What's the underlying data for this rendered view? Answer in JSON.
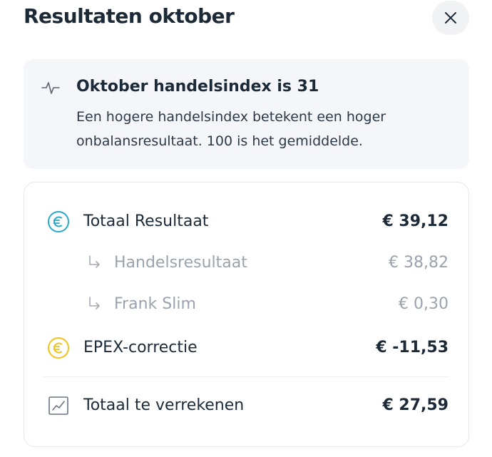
{
  "header": {
    "title": "Resultaten oktober",
    "close_icon": "close-icon"
  },
  "info": {
    "icon": "activity-pulse-icon",
    "heading": "Oktober handelsindex is 31",
    "text": "Een hogere handelsindex betekent een hoger onbalansresultaat. 100 is het gemiddelde."
  },
  "results": {
    "total": {
      "icon": "euro-circle-icon",
      "icon_color": "#2aa8c9",
      "label": "Totaal Resultaat",
      "value": "€ 39,12"
    },
    "sub_items": [
      {
        "icon": "sub-arrow-icon",
        "label": "Handelsresultaat",
        "value": "€ 38,82"
      },
      {
        "icon": "sub-arrow-icon",
        "label": "Frank Slim",
        "value": "€ 0,30"
      }
    ],
    "epex": {
      "icon": "euro-circle-icon",
      "icon_color": "#f2c21b",
      "label": "EPEX-correctie",
      "value": "€ -11,53"
    },
    "settlement": {
      "icon": "chart-trend-icon",
      "label": "Totaal te verrekenen",
      "value": "€ 27,59"
    }
  },
  "colors": {
    "text_primary": "#1c2a38",
    "text_muted": "#9aa3ad",
    "info_background": "#f4f6f9",
    "card_border": "#e6e8eb"
  }
}
